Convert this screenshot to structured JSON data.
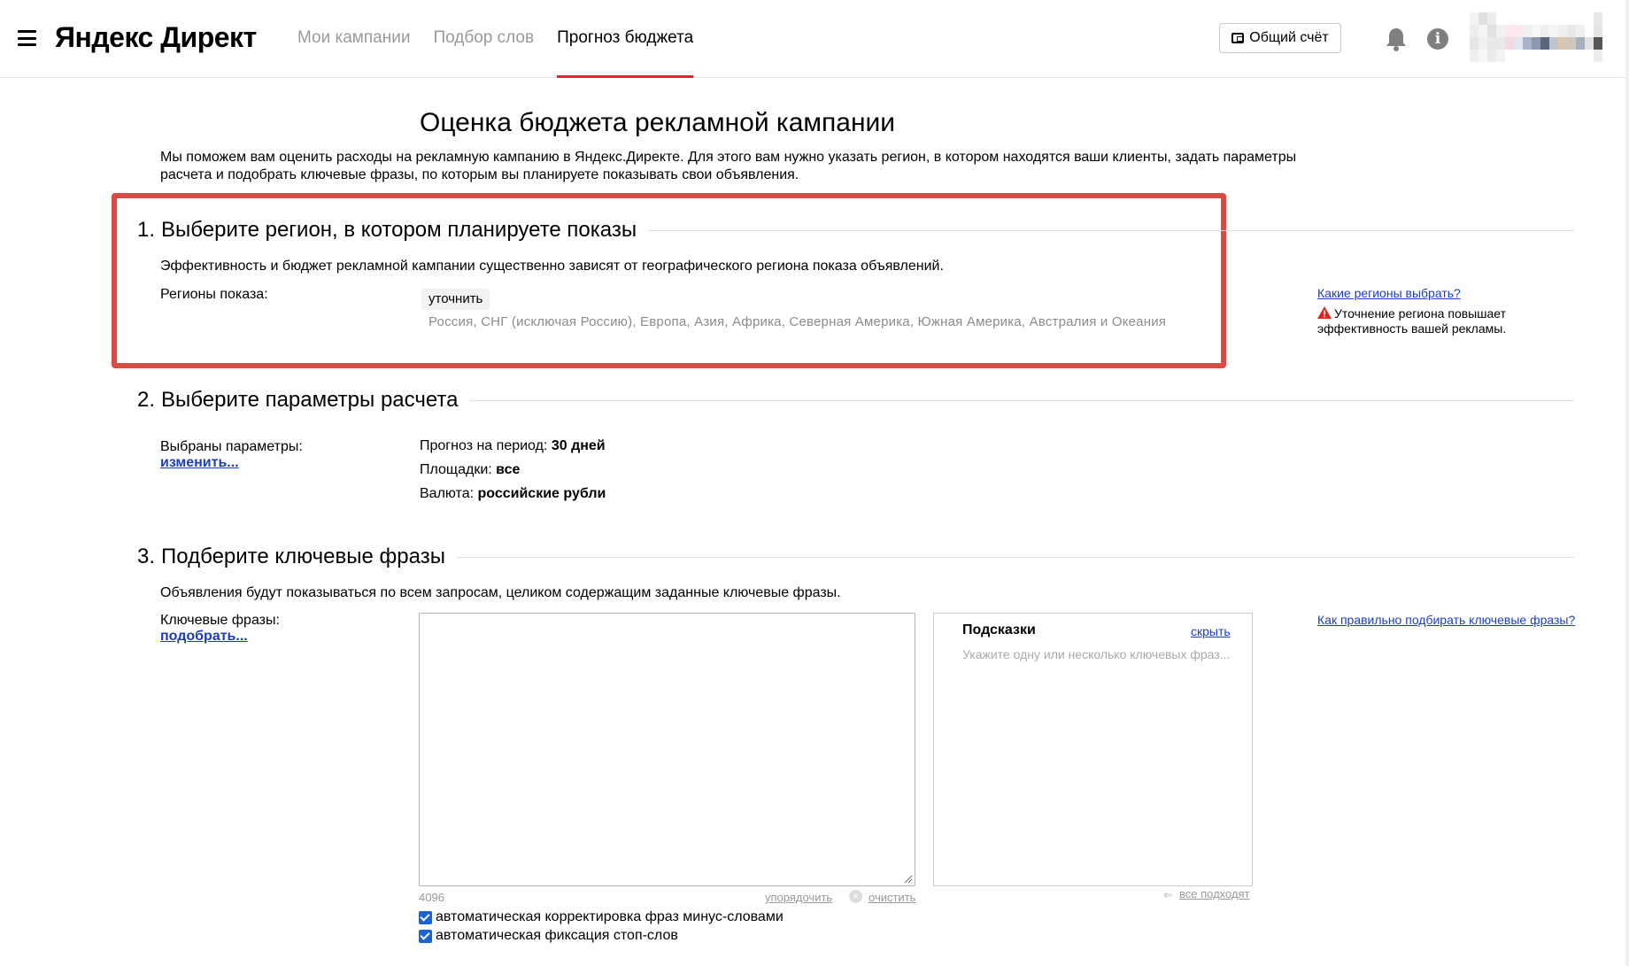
{
  "header": {
    "logo": "Яндекс Директ",
    "nav": [
      {
        "label": "Мои кампании",
        "active": false
      },
      {
        "label": "Подбор слов",
        "active": false
      },
      {
        "label": "Прогноз бюджета",
        "active": true
      }
    ],
    "account_button": "Общий счёт",
    "icons": [
      "menu-icon",
      "wallet-icon",
      "bell-icon",
      "info-icon"
    ]
  },
  "page": {
    "title": "Оценка бюджета рекламной кампании",
    "intro": "Мы поможем вам оценить расходы на рекламную кампанию в Яндекс.Директе. Для этого вам нужно указать регион, в котором находятся ваши клиенты, задать параметры расчета и подобрать ключевые фразы, по которым вы планируете показывать свои объявления."
  },
  "section1": {
    "num": "1.",
    "title": "Выберите регион, в котором планируете показы",
    "description": "Эффективность и бюджет рекламной кампании существенно зависят от географического региона показа объявлений.",
    "regions_label": "Регионы показа:",
    "refine_button": "уточнить",
    "regions": "Россия, СНГ (исключая Россию), Европа, Азия, Африка, Северная Америка, Южная Америка, Австралия и Океания",
    "help_link": "Какие регионы выбрать?",
    "warning": "Уточнение региона повышает эффективность вашей рекламы."
  },
  "section2": {
    "num": "2.",
    "title": "Выберите параметры расчета",
    "selected_label": "Выбраны параметры:",
    "change_link": "изменить...",
    "params": [
      {
        "label": "Прогноз на период:",
        "value": "30 дней"
      },
      {
        "label": "Площадки:",
        "value": "все"
      },
      {
        "label": "Валюта:",
        "value": "российские рубли"
      }
    ]
  },
  "section3": {
    "num": "3.",
    "title": "Подберите ключевые фразы",
    "description": "Объявления будут показываться по всем запросам, целиком содержащим заданные ключевые фразы.",
    "phrases_label": "Ключевые фразы:",
    "pick_link": "подобрать...",
    "textarea_value": "",
    "counter": "4096",
    "sort_link": "упорядочить",
    "clear_link": "очистить",
    "hints_title": "Подсказки",
    "hints_hide": "скрыть",
    "hints_placeholder": "Укажите одну или несколько ключевых фраз...",
    "all_fit": "все подходят",
    "help_link": "Как правильно подбирать ключевые фразы?",
    "checkboxes": [
      {
        "label": "автоматическая корректировка фраз минус-словами",
        "checked": true
      },
      {
        "label": "автоматическая фиксация стоп-слов",
        "checked": true
      }
    ]
  },
  "colors": {
    "accent_red": "#e2242d",
    "highlight_box": "#d94a43",
    "link_blue": "#1a3dc1",
    "checkbox_blue": "#1565d8"
  }
}
